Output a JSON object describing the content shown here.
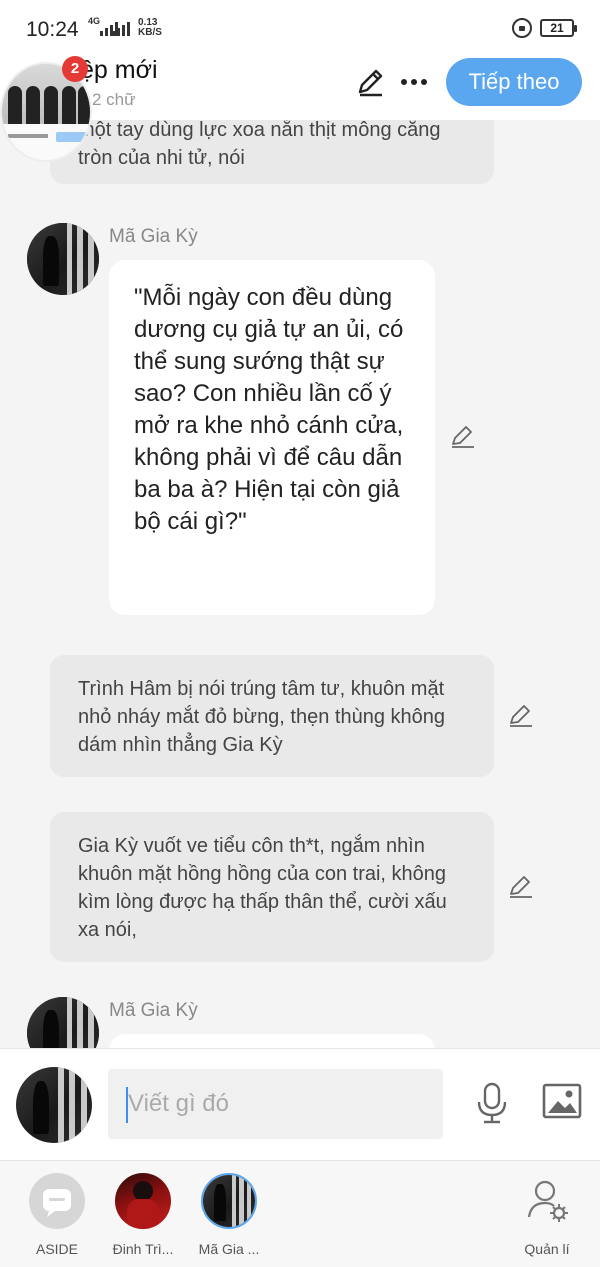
{
  "status_bar": {
    "time": "10:24",
    "network_type": "4G",
    "net_speed_value": "0.13",
    "net_speed_unit": "KB/S",
    "battery": "21"
  },
  "header": {
    "title": "ệp mới",
    "word_count": "2 chữ",
    "next_label": "Tiếp theo",
    "notification_count": "2"
  },
  "messages": [
    {
      "type": "narration",
      "text": "một tay dùng lực xoa nắn thịt mông căng tròn của nhi tử, nói"
    },
    {
      "type": "dialogue",
      "character": "Mã Gia Kỳ",
      "text": "\"Mỗi ngày con đều dùng dương cụ giả tự an ủi, có thể sung sướng thật sự sao? Con nhiều lần cố ý mở ra khe nhỏ cánh cửa, không phải vì để câu dẫn ba ba à? Hiện tại còn giả bộ cái gì?\""
    },
    {
      "type": "narration",
      "text": "Trình Hâm bị nói trúng tâm tư, khuôn mặt nhỏ nháy mắt đỏ bừng, thẹn thùng không dám nhìn thẳng Gia Kỳ"
    },
    {
      "type": "narration",
      "text": "Gia Kỳ vuốt ve tiểu côn th*t, ngắm nhìn khuôn mặt hồng hồng của con trai, không kìm lòng được hạ thấp thân thể, cười xấu xa nói,"
    },
    {
      "type": "dialogue",
      "character": "Mã Gia Kỳ",
      "text": ""
    }
  ],
  "composer": {
    "placeholder": "Viết gì đó"
  },
  "bottom_nav": [
    {
      "label": "ASIDE",
      "icon": "chat-bubble-icon"
    },
    {
      "label": "Đinh Trì...",
      "icon": "character-avatar"
    },
    {
      "label": "Mã Gia ...",
      "icon": "character-avatar"
    },
    {
      "label": "Quản lí",
      "icon": "user-gear-icon"
    }
  ],
  "colors": {
    "accent": "#5aa6ef",
    "badge": "#e53935",
    "narration_bg": "#e9e9e9",
    "speech_bg": "#ffffff"
  }
}
